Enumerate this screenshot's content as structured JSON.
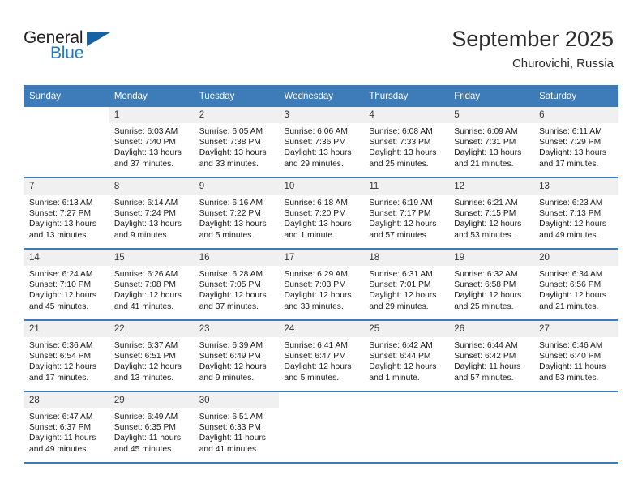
{
  "brand": {
    "name_top": "General",
    "name_bottom": "Blue",
    "triangle_icon": "triangle-logo-icon",
    "color_dark": "#231f20",
    "color_blue": "#1e7ac4"
  },
  "header": {
    "title": "September 2025",
    "subtitle": "Churovichi, Russia"
  },
  "theme": {
    "header_blue": "#3d7cb8",
    "daynum_bg": "#f0f0f0",
    "cell_bg": "#ffffff",
    "text": "#1a1a1a"
  },
  "columns": [
    "Sunday",
    "Monday",
    "Tuesday",
    "Wednesday",
    "Thursday",
    "Friday",
    "Saturday"
  ],
  "labels": {
    "sunrise": "Sunrise:",
    "sunset": "Sunset:",
    "daylight": "Daylight:"
  },
  "weeks": [
    [
      {
        "day": "",
        "empty": true
      },
      {
        "day": "1",
        "sunrise": "Sunrise: 6:03 AM",
        "sunset": "Sunset: 7:40 PM",
        "daylight1": "Daylight: 13 hours",
        "daylight2": "and 37 minutes."
      },
      {
        "day": "2",
        "sunrise": "Sunrise: 6:05 AM",
        "sunset": "Sunset: 7:38 PM",
        "daylight1": "Daylight: 13 hours",
        "daylight2": "and 33 minutes."
      },
      {
        "day": "3",
        "sunrise": "Sunrise: 6:06 AM",
        "sunset": "Sunset: 7:36 PM",
        "daylight1": "Daylight: 13 hours",
        "daylight2": "and 29 minutes."
      },
      {
        "day": "4",
        "sunrise": "Sunrise: 6:08 AM",
        "sunset": "Sunset: 7:33 PM",
        "daylight1": "Daylight: 13 hours",
        "daylight2": "and 25 minutes."
      },
      {
        "day": "5",
        "sunrise": "Sunrise: 6:09 AM",
        "sunset": "Sunset: 7:31 PM",
        "daylight1": "Daylight: 13 hours",
        "daylight2": "and 21 minutes."
      },
      {
        "day": "6",
        "sunrise": "Sunrise: 6:11 AM",
        "sunset": "Sunset: 7:29 PM",
        "daylight1": "Daylight: 13 hours",
        "daylight2": "and 17 minutes."
      }
    ],
    [
      {
        "day": "7",
        "sunrise": "Sunrise: 6:13 AM",
        "sunset": "Sunset: 7:27 PM",
        "daylight1": "Daylight: 13 hours",
        "daylight2": "and 13 minutes."
      },
      {
        "day": "8",
        "sunrise": "Sunrise: 6:14 AM",
        "sunset": "Sunset: 7:24 PM",
        "daylight1": "Daylight: 13 hours",
        "daylight2": "and 9 minutes."
      },
      {
        "day": "9",
        "sunrise": "Sunrise: 6:16 AM",
        "sunset": "Sunset: 7:22 PM",
        "daylight1": "Daylight: 13 hours",
        "daylight2": "and 5 minutes."
      },
      {
        "day": "10",
        "sunrise": "Sunrise: 6:18 AM",
        "sunset": "Sunset: 7:20 PM",
        "daylight1": "Daylight: 13 hours",
        "daylight2": "and 1 minute."
      },
      {
        "day": "11",
        "sunrise": "Sunrise: 6:19 AM",
        "sunset": "Sunset: 7:17 PM",
        "daylight1": "Daylight: 12 hours",
        "daylight2": "and 57 minutes."
      },
      {
        "day": "12",
        "sunrise": "Sunrise: 6:21 AM",
        "sunset": "Sunset: 7:15 PM",
        "daylight1": "Daylight: 12 hours",
        "daylight2": "and 53 minutes."
      },
      {
        "day": "13",
        "sunrise": "Sunrise: 6:23 AM",
        "sunset": "Sunset: 7:13 PM",
        "daylight1": "Daylight: 12 hours",
        "daylight2": "and 49 minutes."
      }
    ],
    [
      {
        "day": "14",
        "sunrise": "Sunrise: 6:24 AM",
        "sunset": "Sunset: 7:10 PM",
        "daylight1": "Daylight: 12 hours",
        "daylight2": "and 45 minutes."
      },
      {
        "day": "15",
        "sunrise": "Sunrise: 6:26 AM",
        "sunset": "Sunset: 7:08 PM",
        "daylight1": "Daylight: 12 hours",
        "daylight2": "and 41 minutes."
      },
      {
        "day": "16",
        "sunrise": "Sunrise: 6:28 AM",
        "sunset": "Sunset: 7:05 PM",
        "daylight1": "Daylight: 12 hours",
        "daylight2": "and 37 minutes."
      },
      {
        "day": "17",
        "sunrise": "Sunrise: 6:29 AM",
        "sunset": "Sunset: 7:03 PM",
        "daylight1": "Daylight: 12 hours",
        "daylight2": "and 33 minutes."
      },
      {
        "day": "18",
        "sunrise": "Sunrise: 6:31 AM",
        "sunset": "Sunset: 7:01 PM",
        "daylight1": "Daylight: 12 hours",
        "daylight2": "and 29 minutes."
      },
      {
        "day": "19",
        "sunrise": "Sunrise: 6:32 AM",
        "sunset": "Sunset: 6:58 PM",
        "daylight1": "Daylight: 12 hours",
        "daylight2": "and 25 minutes."
      },
      {
        "day": "20",
        "sunrise": "Sunrise: 6:34 AM",
        "sunset": "Sunset: 6:56 PM",
        "daylight1": "Daylight: 12 hours",
        "daylight2": "and 21 minutes."
      }
    ],
    [
      {
        "day": "21",
        "sunrise": "Sunrise: 6:36 AM",
        "sunset": "Sunset: 6:54 PM",
        "daylight1": "Daylight: 12 hours",
        "daylight2": "and 17 minutes."
      },
      {
        "day": "22",
        "sunrise": "Sunrise: 6:37 AM",
        "sunset": "Sunset: 6:51 PM",
        "daylight1": "Daylight: 12 hours",
        "daylight2": "and 13 minutes."
      },
      {
        "day": "23",
        "sunrise": "Sunrise: 6:39 AM",
        "sunset": "Sunset: 6:49 PM",
        "daylight1": "Daylight: 12 hours",
        "daylight2": "and 9 minutes."
      },
      {
        "day": "24",
        "sunrise": "Sunrise: 6:41 AM",
        "sunset": "Sunset: 6:47 PM",
        "daylight1": "Daylight: 12 hours",
        "daylight2": "and 5 minutes."
      },
      {
        "day": "25",
        "sunrise": "Sunrise: 6:42 AM",
        "sunset": "Sunset: 6:44 PM",
        "daylight1": "Daylight: 12 hours",
        "daylight2": "and 1 minute."
      },
      {
        "day": "26",
        "sunrise": "Sunrise: 6:44 AM",
        "sunset": "Sunset: 6:42 PM",
        "daylight1": "Daylight: 11 hours",
        "daylight2": "and 57 minutes."
      },
      {
        "day": "27",
        "sunrise": "Sunrise: 6:46 AM",
        "sunset": "Sunset: 6:40 PM",
        "daylight1": "Daylight: 11 hours",
        "daylight2": "and 53 minutes."
      }
    ],
    [
      {
        "day": "28",
        "sunrise": "Sunrise: 6:47 AM",
        "sunset": "Sunset: 6:37 PM",
        "daylight1": "Daylight: 11 hours",
        "daylight2": "and 49 minutes."
      },
      {
        "day": "29",
        "sunrise": "Sunrise: 6:49 AM",
        "sunset": "Sunset: 6:35 PM",
        "daylight1": "Daylight: 11 hours",
        "daylight2": "and 45 minutes."
      },
      {
        "day": "30",
        "sunrise": "Sunrise: 6:51 AM",
        "sunset": "Sunset: 6:33 PM",
        "daylight1": "Daylight: 11 hours",
        "daylight2": "and 41 minutes."
      },
      {
        "day": "",
        "empty": true
      },
      {
        "day": "",
        "empty": true
      },
      {
        "day": "",
        "empty": true
      },
      {
        "day": "",
        "empty": true
      }
    ]
  ]
}
